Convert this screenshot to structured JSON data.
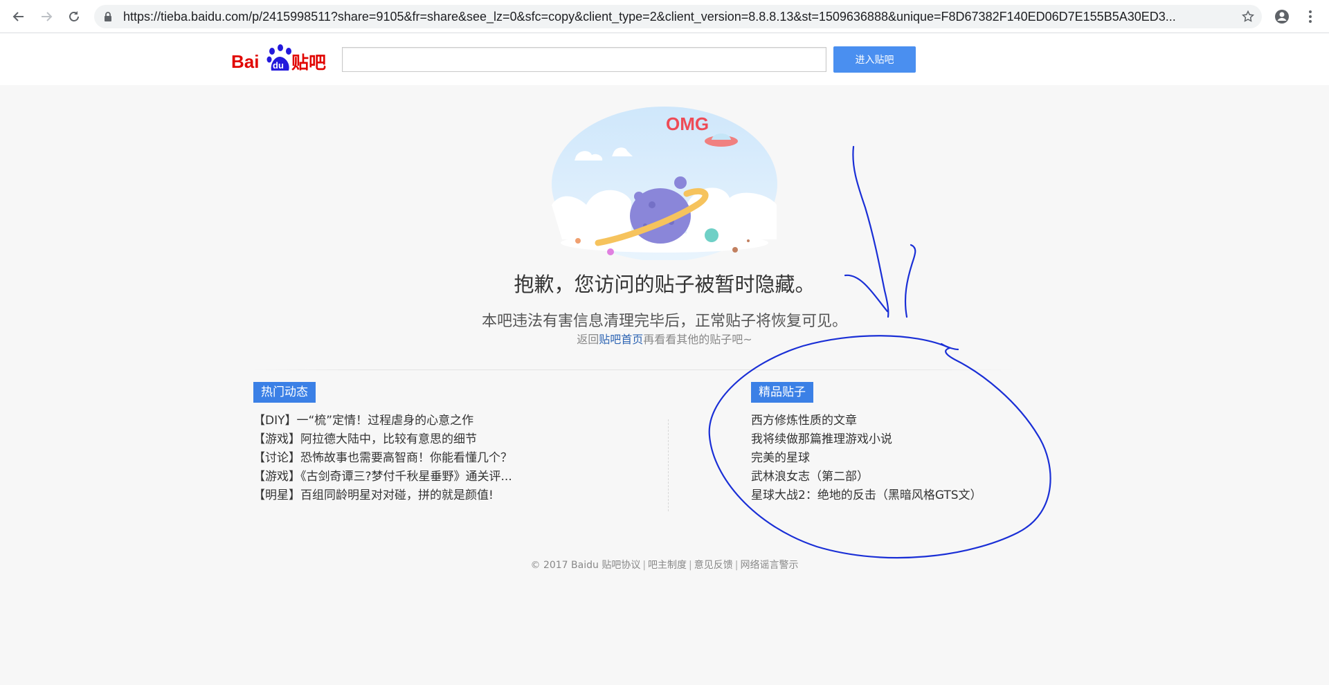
{
  "browser": {
    "url": "https://tieba.baidu.com/p/2415998511?share=9105&fr=share&see_lz=0&sfc=copy&client_type=2&client_version=8.8.8.13&st=1509636888&unique=F8D67382F140ED06D7E155B5A30ED3..."
  },
  "header": {
    "logo_text": "Bai du 贴吧",
    "search_placeholder": "",
    "search_button": "进入贴吧"
  },
  "main": {
    "illustration_text": "OMG",
    "headline": "抱歉，您访问的贴子被暂时隐藏。",
    "subline": "本吧违法有害信息清理完毕后，正常贴子将恢复可见。",
    "back_prefix": "返回",
    "back_link": "贴吧首页",
    "back_suffix": "再看看其他的贴子吧~"
  },
  "hot": {
    "title": "热门动态",
    "items": [
      "【DIY】一“梳”定情！过程虐身的心意之作",
      "【游戏】阿拉德大陆中，比较有意思的细节",
      "【讨论】恐怖故事也需要高智商！你能看懂几个？",
      "【游戏】《古剑奇谭三?梦付千秋星垂野》通关评...",
      "【明星】百组同龄明星对对碰，拼的就是颜值!"
    ]
  },
  "featured": {
    "title": "精品贴子",
    "items": [
      "西方修炼性质的文章",
      "我将续做那篇推理游戏小说",
      "完美的星球",
      "武林浪女志（第二部）",
      "星球大战2：绝地的反击（黑暗风格GTS文）"
    ]
  },
  "footer": {
    "copyright": "© 2017 Baidu",
    "links": [
      "贴吧协议",
      "吧主制度",
      "意见反馈",
      "网络谣言警示"
    ]
  },
  "colors": {
    "accent": "#3b80e6",
    "link": "#2d64b3",
    "annotation_ink": "#1a2fd6"
  },
  "icons": [
    "back-arrow-icon",
    "forward-arrow-icon",
    "reload-icon",
    "lock-icon",
    "star-icon",
    "account-icon",
    "menu-dots-icon"
  ]
}
